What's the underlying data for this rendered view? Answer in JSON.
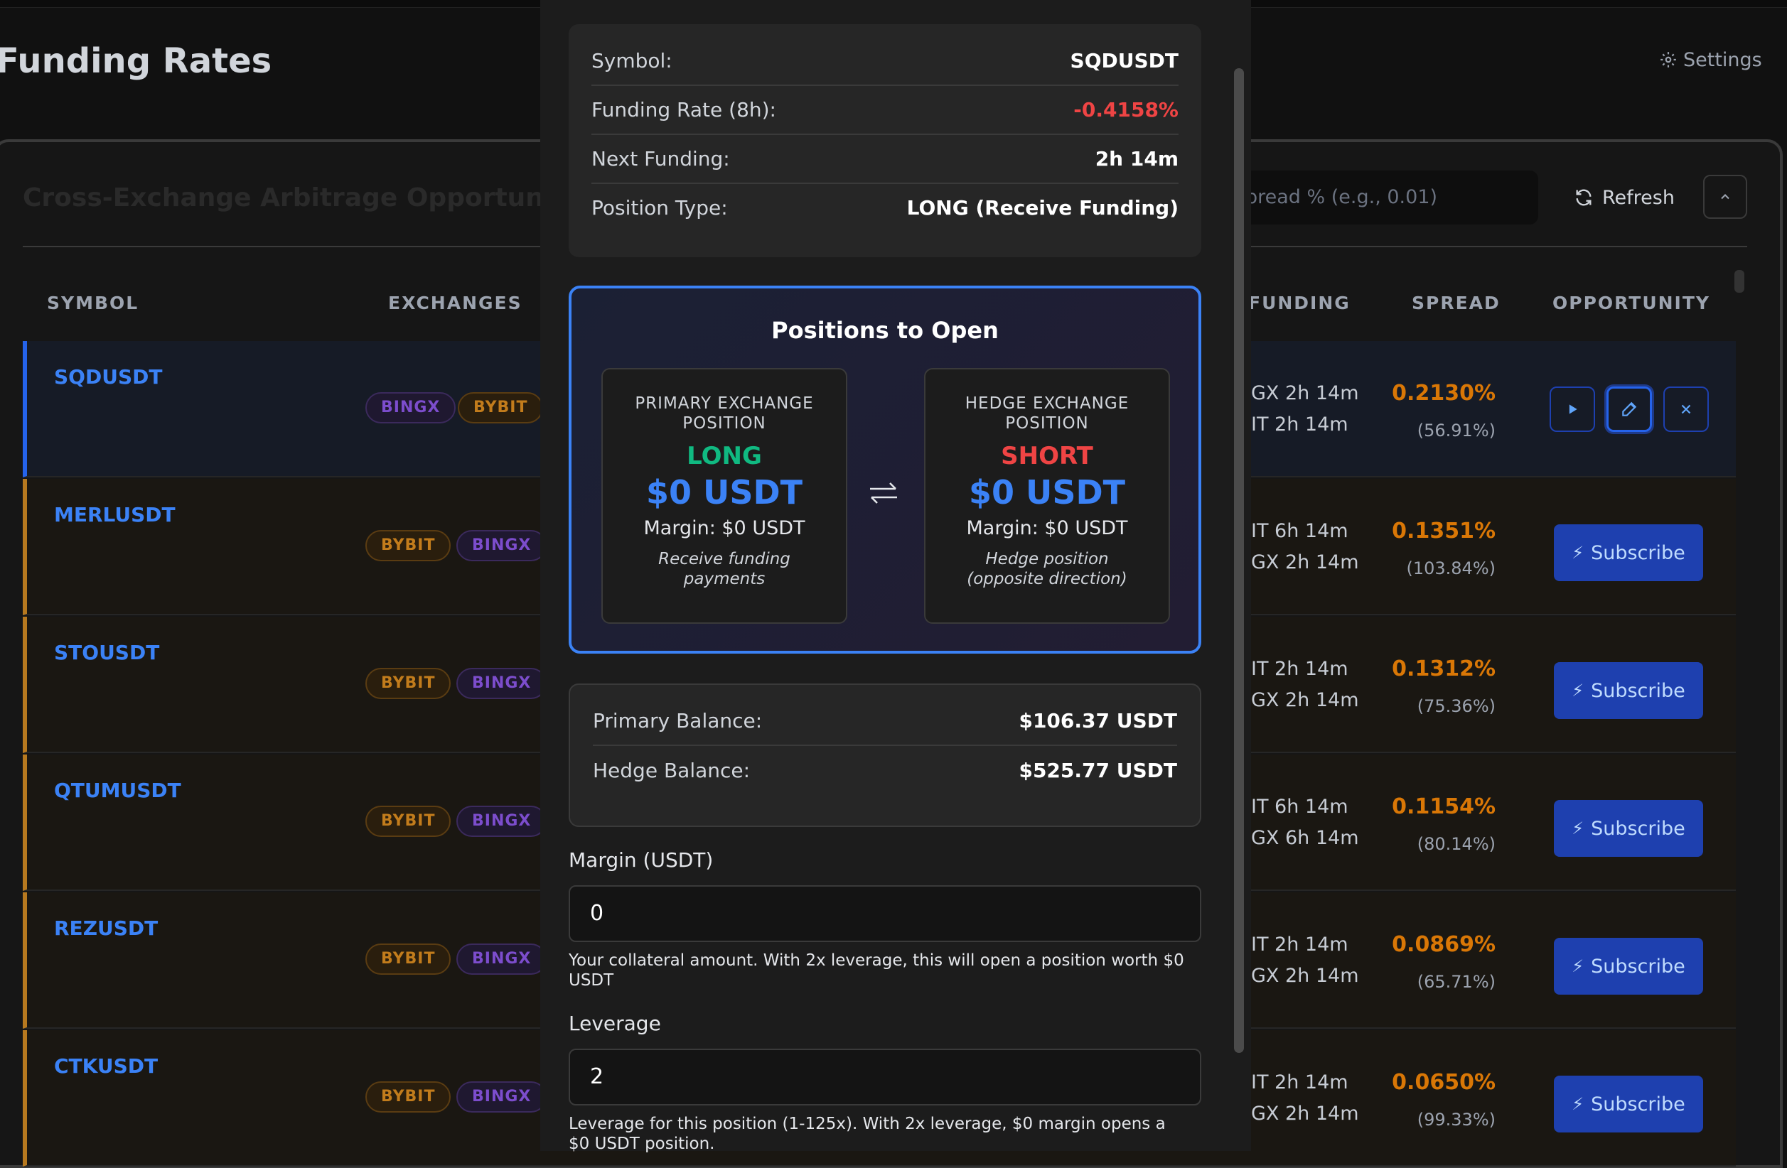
{
  "page": {
    "title": "Funding Rates",
    "settings_label": "Settings"
  },
  "panel": {
    "title": "Cross-Exchange Arbitrage Opportunities",
    "search_placeholder": "pread % (e.g., 0.01)",
    "refresh_label": "Refresh",
    "columns": {
      "symbol": "SYMBOL",
      "exchanges": "EXCHANGES",
      "funding": "FUNDING",
      "spread": "SPREAD",
      "opportunity": "OPPORTUNITY"
    },
    "subscribe_label": "Subscribe",
    "rows": [
      {
        "symbol": "SQDUSDT",
        "ex1": "BINGX",
        "ex2": "BYBIT",
        "fund1": "GX 2h 14m",
        "fund2": "IT 2h 14m",
        "spread": "0.2130%",
        "spread_pct": "(56.91%)"
      },
      {
        "symbol": "MERLUSDT",
        "ex1": "BYBIT",
        "ex2": "BINGX",
        "fund1": "IT 6h 14m",
        "fund2": "GX 2h 14m",
        "spread": "0.1351%",
        "spread_pct": "(103.84%)"
      },
      {
        "symbol": "STOUSDT",
        "ex1": "BYBIT",
        "ex2": "BINGX",
        "fund1": "IT 2h 14m",
        "fund2": "GX 2h 14m",
        "spread": "0.1312%",
        "spread_pct": "(75.36%)"
      },
      {
        "symbol": "QTUMUSDT",
        "ex1": "BYBIT",
        "ex2": "BINGX",
        "fund1": "IT 6h 14m",
        "fund2": "GX 6h 14m",
        "spread": "0.1154%",
        "spread_pct": "(80.14%)"
      },
      {
        "symbol": "REZUSDT",
        "ex1": "BYBIT",
        "ex2": "BINGX",
        "fund1": "IT 2h 14m",
        "fund2": "GX 2h 14m",
        "spread": "0.0869%",
        "spread_pct": "(65.71%)"
      },
      {
        "symbol": "CTKUSDT",
        "ex1": "BYBIT",
        "ex2": "BINGX",
        "fund1": "IT 2h 14m",
        "fund2": "GX 2h 14m",
        "spread": "0.0650%",
        "spread_pct": "(99.33%)"
      }
    ]
  },
  "modal": {
    "info": [
      {
        "label": "Symbol:",
        "value": "SQDUSDT"
      },
      {
        "label": "Funding Rate (8h):",
        "value": "-0.4158%"
      },
      {
        "label": "Next Funding:",
        "value": "2h 14m"
      },
      {
        "label": "Position Type:",
        "value": "LONG (Receive Funding)"
      }
    ],
    "positions_title": "Positions to Open",
    "primary": {
      "heading": "PRIMARY EXCHANGE POSITION",
      "direction": "LONG",
      "amount": "$0 USDT",
      "margin": "Margin: $0 USDT",
      "note": "Receive funding payments"
    },
    "hedge": {
      "heading": "HEDGE EXCHANGE POSITION",
      "direction": "SHORT",
      "amount": "$0 USDT",
      "margin": "Margin: $0 USDT",
      "note": "Hedge position (opposite direction)"
    },
    "balances": [
      {
        "label": "Primary Balance:",
        "value": "$106.37 USDT"
      },
      {
        "label": "Hedge Balance:",
        "value": "$525.77 USDT"
      }
    ],
    "margin_field": {
      "label": "Margin (USDT)",
      "value": "0",
      "help": "Your collateral amount. With 2x leverage, this will open a position worth $0 USDT"
    },
    "leverage_field": {
      "label": "Leverage",
      "value": "2",
      "help": "Leverage for this position (1-125x). With 2x leverage, $0 margin opens a $0 USDT position."
    }
  },
  "colors": {
    "accent": "#3b82f6",
    "negative": "#ef4444",
    "positive": "#10b981",
    "spread": "#d97706",
    "bingx": "#7c4dcc",
    "bybit": "#c27c1c"
  }
}
